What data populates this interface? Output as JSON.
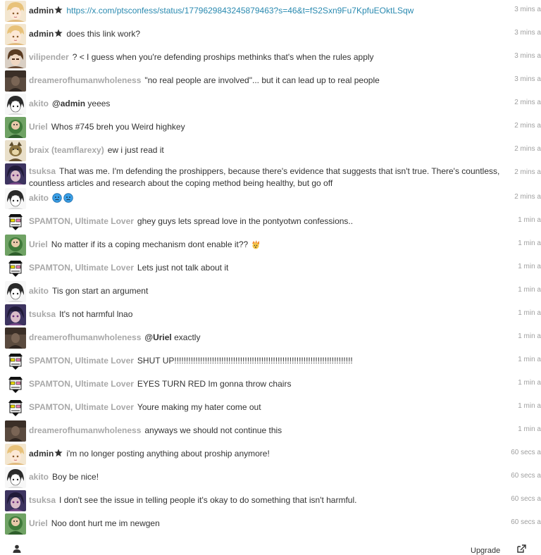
{
  "colors": {
    "accent_link": "#2a8ab0",
    "name_muted": "#a8a8a8",
    "text": "#333333",
    "timestamp": "#a0a0a0"
  },
  "messages": [
    {
      "user": "admin",
      "admin": true,
      "avatar": "avatar-blonde-anime",
      "parts": [
        {
          "t": "link",
          "v": "https://x.com/ptsconfess/status/1779629843245879463?s=46&t=fS2Sxn9Fu7KpfuEOktLSqw"
        }
      ],
      "time": "3 mins a"
    },
    {
      "user": "admin",
      "admin": true,
      "avatar": "avatar-blonde-anime",
      "parts": [
        {
          "t": "text",
          "v": "does this link work?"
        }
      ],
      "time": "3 mins a"
    },
    {
      "user": "vilipender",
      "avatar": "avatar-brown-hair",
      "parts": [
        {
          "t": "text",
          "v": "? < I guess when you're defending proships methinks that's when the rules apply"
        }
      ],
      "time": "3 mins a"
    },
    {
      "user": "dreamerofhumanwholeness",
      "avatar": "avatar-dark-figure",
      "parts": [
        {
          "t": "text",
          "v": "\"no real people are involved\"... but it can lead up to real people"
        }
      ],
      "time": "3 mins a"
    },
    {
      "user": "akito",
      "avatar": "avatar-sketch-girl",
      "parts": [
        {
          "t": "mention",
          "v": "@admin"
        },
        {
          "t": "text",
          "v": " yeees"
        }
      ],
      "time": "2 mins a"
    },
    {
      "user": "Uriel",
      "avatar": "avatar-green-blob",
      "parts": [
        {
          "t": "text",
          "v": "Whos #745 breh you Weird highkey"
        }
      ],
      "time": "2 mins a"
    },
    {
      "user": "braix (teamflarexy)",
      "avatar": "avatar-fox-character",
      "parts": [
        {
          "t": "text",
          "v": "ew i just read it"
        }
      ],
      "time": "2 mins a"
    },
    {
      "user": "tsuksa",
      "tall": true,
      "avatar": "avatar-purple-anime",
      "parts": [
        {
          "t": "text",
          "v": "That was me. I'm defending the proshippers, because there's evidence that suggests that isn't true. There's countless, countless articles and research about the coping method being healthy, but go off"
        }
      ],
      "time": "2 mins a"
    },
    {
      "user": "akito",
      "avatar": "avatar-sketch-girl",
      "parts": [
        {
          "t": "emoji",
          "v": "worried-face-emoji"
        },
        {
          "t": "emoji",
          "v": "worried-face-emoji"
        }
      ],
      "time": "2 mins a"
    },
    {
      "user": "SPAMTON, Ultimate Lover",
      "avatar": "avatar-spamton",
      "parts": [
        {
          "t": "text",
          "v": "ghey guys lets spread love in the pontyotwn confessions.."
        }
      ],
      "time": "1 min a"
    },
    {
      "user": "Uriel",
      "avatar": "avatar-green-blob",
      "parts": [
        {
          "t": "text",
          "v": "No matter if its a coping mechanism dont enable it?? "
        },
        {
          "t": "emoji",
          "v": "exploding-head-emoji"
        }
      ],
      "time": "1 min a"
    },
    {
      "user": "SPAMTON, Ultimate Lover",
      "avatar": "avatar-spamton",
      "parts": [
        {
          "t": "text",
          "v": "Lets just not talk about it"
        }
      ],
      "time": "1 min a"
    },
    {
      "user": "akito",
      "avatar": "avatar-sketch-girl",
      "parts": [
        {
          "t": "text",
          "v": "Tis gon start an argument"
        }
      ],
      "time": "1 min a"
    },
    {
      "user": "tsuksa",
      "avatar": "avatar-purple-anime",
      "parts": [
        {
          "t": "text",
          "v": "It's not harmful lnao"
        }
      ],
      "time": "1 min a"
    },
    {
      "user": "dreamerofhumanwholeness",
      "avatar": "avatar-dark-figure",
      "parts": [
        {
          "t": "mention",
          "v": "@Uriel"
        },
        {
          "t": "text",
          "v": " exactly"
        }
      ],
      "time": "1 min a"
    },
    {
      "user": "SPAMTON, Ultimate Lover",
      "avatar": "avatar-spamton",
      "parts": [
        {
          "t": "text",
          "v": "SHUT UP!!!!!!!!!!!!!!!!!!!!!!!!!!!!!!!!!!!!!!!!!!!!!!!!!!!!!!!!!!!!!!!!!!!!!!!!!!!!"
        }
      ],
      "time": "1 min a"
    },
    {
      "user": "SPAMTON, Ultimate Lover",
      "avatar": "avatar-spamton",
      "parts": [
        {
          "t": "text",
          "v": "EYES TURN RED Im gonna throw chairs"
        }
      ],
      "time": "1 min a"
    },
    {
      "user": "SPAMTON, Ultimate Lover",
      "avatar": "avatar-spamton",
      "parts": [
        {
          "t": "text",
          "v": "Youre making my hater come out"
        }
      ],
      "time": "1 min a"
    },
    {
      "user": "dreamerofhumanwholeness",
      "avatar": "avatar-dark-figure",
      "parts": [
        {
          "t": "text",
          "v": "anyways we should not continue this"
        }
      ],
      "time": "1 min a"
    },
    {
      "user": "admin",
      "admin": true,
      "avatar": "avatar-blonde-anime",
      "parts": [
        {
          "t": "text",
          "v": "i'm no longer posting anything about proship anymore!"
        }
      ],
      "time": "60 secs a"
    },
    {
      "user": "akito",
      "avatar": "avatar-sketch-girl",
      "parts": [
        {
          "t": "text",
          "v": "Boy be nice!"
        }
      ],
      "time": "60 secs a"
    },
    {
      "user": "tsuksa",
      "avatar": "avatar-purple-anime",
      "parts": [
        {
          "t": "text",
          "v": "I don't see the issue in telling people it's okay to do something that isn't harmful."
        }
      ],
      "time": "60 secs a"
    },
    {
      "user": "Uriel",
      "avatar": "avatar-green-blob",
      "parts": [
        {
          "t": "text",
          "v": "Noo dont hurt me im newgen"
        }
      ],
      "time": "60 secs a"
    }
  ],
  "footer": {
    "user_icon": "user-icon",
    "upgrade_label": "Upgrade",
    "popout_icon": "external-link-icon"
  }
}
